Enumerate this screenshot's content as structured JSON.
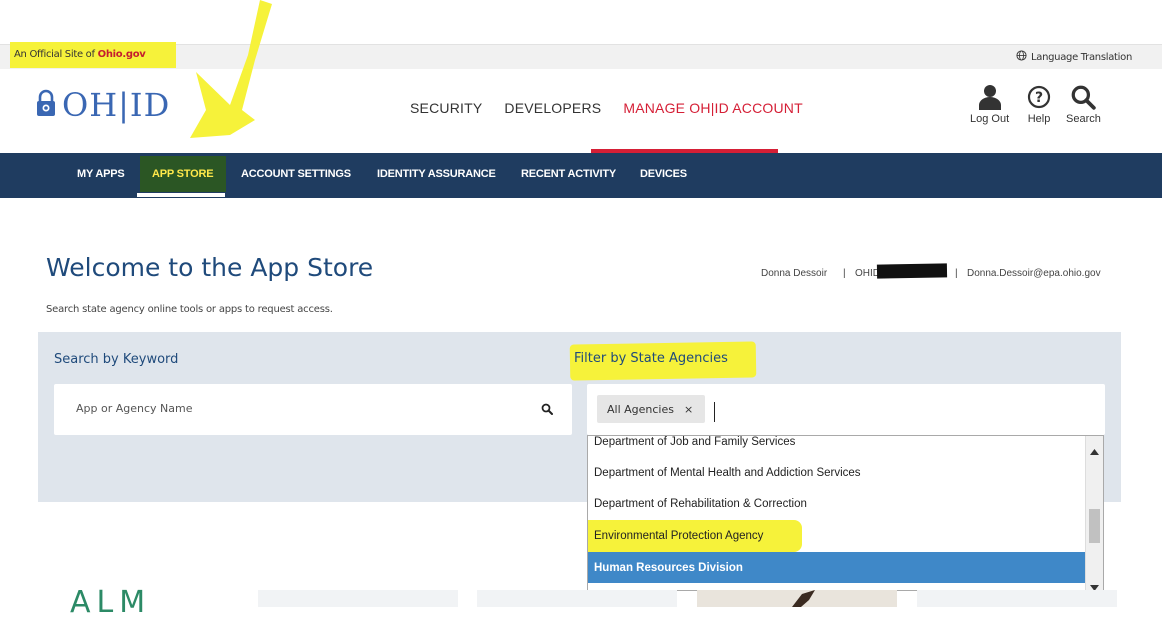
{
  "official": {
    "prefix": "An Official Site of",
    "brand": "Ohio.gov"
  },
  "language": {
    "label": "Language Translation",
    "icon": "globe-icon"
  },
  "logo": {
    "text": "OH|ID",
    "icon": "lock-icon"
  },
  "main_nav": {
    "items": [
      "SECURITY",
      "DEVELOPERS",
      "MANAGE OH|ID ACCOUNT"
    ],
    "active": "MANAGE OH|ID ACCOUNT"
  },
  "utility": {
    "logout": "Log Out",
    "help": "Help",
    "search": "Search"
  },
  "subnav": {
    "items": [
      "MY APPS",
      "APP STORE",
      "ACCOUNT SETTINGS",
      "IDENTITY ASSURANCE",
      "RECENT ACTIVITY",
      "DEVICES"
    ],
    "selected": "APP STORE"
  },
  "page": {
    "title": "Welcome to the App Store",
    "subtitle": "Search state agency online tools or apps to request access.",
    "user_name": "Donna Dessoir",
    "ohid_label": "OHID:",
    "user_email": "Donna.Dessoir@epa.ohio.gov"
  },
  "search": {
    "label": "Search by Keyword",
    "placeholder": "App or Agency Name"
  },
  "filter": {
    "label": "Filter by State Agencies",
    "chip": "All Agencies",
    "chip_remove": "×",
    "options": [
      "Department of Job and Family Services",
      "Department of Mental Health and Addiction Services",
      "Department of Rehabilitation & Correction",
      "Environmental Protection Agency",
      "Human Resources Division"
    ],
    "highlighted": "Human Resources Division"
  },
  "cards": {
    "first_logo": "ALM"
  },
  "colors": {
    "brand_blue": "#1f3c60",
    "accent_red": "#d51f36",
    "highlight_yellow": "#f6f23a",
    "selected_option": "#3f88c8"
  }
}
